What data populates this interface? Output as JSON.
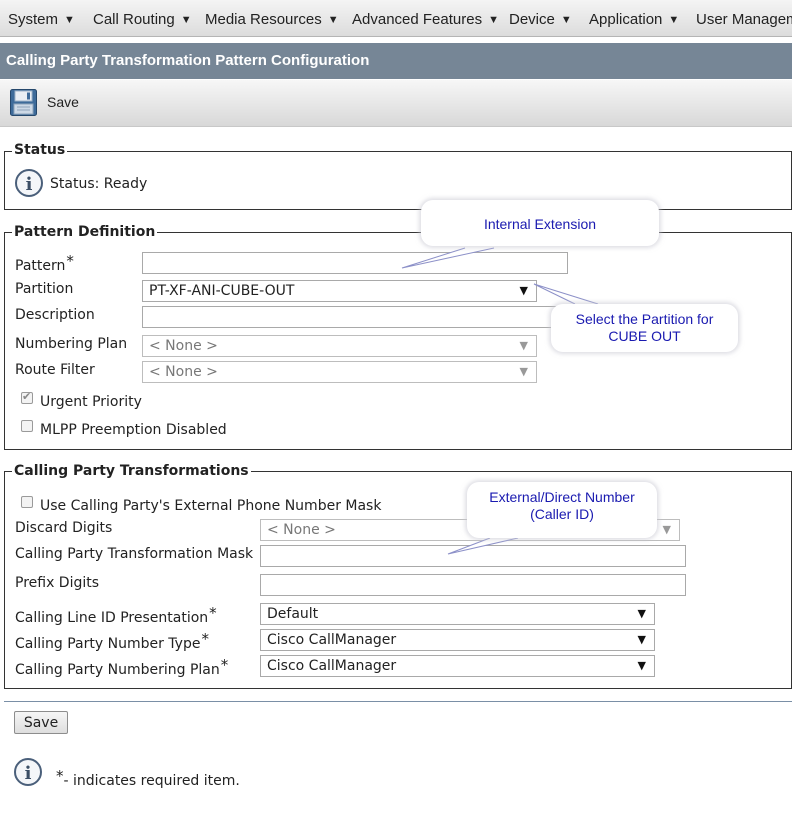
{
  "menu": [
    {
      "label": "System"
    },
    {
      "label": "Call Routing"
    },
    {
      "label": "Media Resources"
    },
    {
      "label": "Advanced Features"
    },
    {
      "label": "Device"
    },
    {
      "label": "Application"
    },
    {
      "label": "User Managem"
    }
  ],
  "page_title": "Calling Party Transformation Pattern Configuration",
  "toolbar": {
    "save_label": "Save",
    "save_icon": "floppy-disk-icon"
  },
  "status": {
    "legend": "Status",
    "text": "Status: Ready",
    "icon": "info-icon"
  },
  "pattern_definition": {
    "legend": "Pattern Definition",
    "pattern": {
      "label": "Pattern",
      "required_mark": "*",
      "value": ""
    },
    "partition": {
      "label": "Partition",
      "value": "PT-XF-ANI-CUBE-OUT"
    },
    "description": {
      "label": "Description",
      "value": ""
    },
    "numbering_plan": {
      "label": "Numbering Plan",
      "value": "< None >"
    },
    "route_filter": {
      "label": "Route Filter",
      "value": "< None >"
    },
    "urgent_priority": {
      "label": "Urgent Priority",
      "checked": true,
      "disabled": true
    },
    "mlpp": {
      "label": "MLPP Preemption Disabled",
      "checked": false
    }
  },
  "calling_party_transformations": {
    "legend": "Calling Party Transformations",
    "use_external_mask": {
      "label": "Use Calling Party's External Phone Number Mask",
      "checked": false
    },
    "discard_digits": {
      "label": "Discard Digits",
      "value": "< None >"
    },
    "transformation_mask": {
      "label": "Calling Party Transformation Mask",
      "value": ""
    },
    "prefix_digits": {
      "label": "Prefix Digits",
      "value": ""
    },
    "cli_presentation": {
      "label": "Calling Line ID Presentation",
      "required_mark": "*",
      "value": "Default"
    },
    "number_type": {
      "label": "Calling Party Number Type",
      "required_mark": "*",
      "value": "Cisco CallManager"
    },
    "numbering_plan": {
      "label": "Calling Party Numbering Plan",
      "required_mark": "*",
      "value": "Cisco CallManager"
    }
  },
  "callouts": {
    "internal_extension": "Internal Extension",
    "partition_line1": "Select the Partition for",
    "partition_line2": "CUBE OUT",
    "external_line1": "External/Direct Number",
    "external_line2": "(Caller ID)"
  },
  "footer": {
    "save_label": "Save",
    "required_note_star": "*",
    "required_note": "- indicates required item."
  },
  "colors": {
    "title_bar": "#768696",
    "callout_text": "#1a1ab0",
    "info_icon": "#4a5f7a"
  }
}
